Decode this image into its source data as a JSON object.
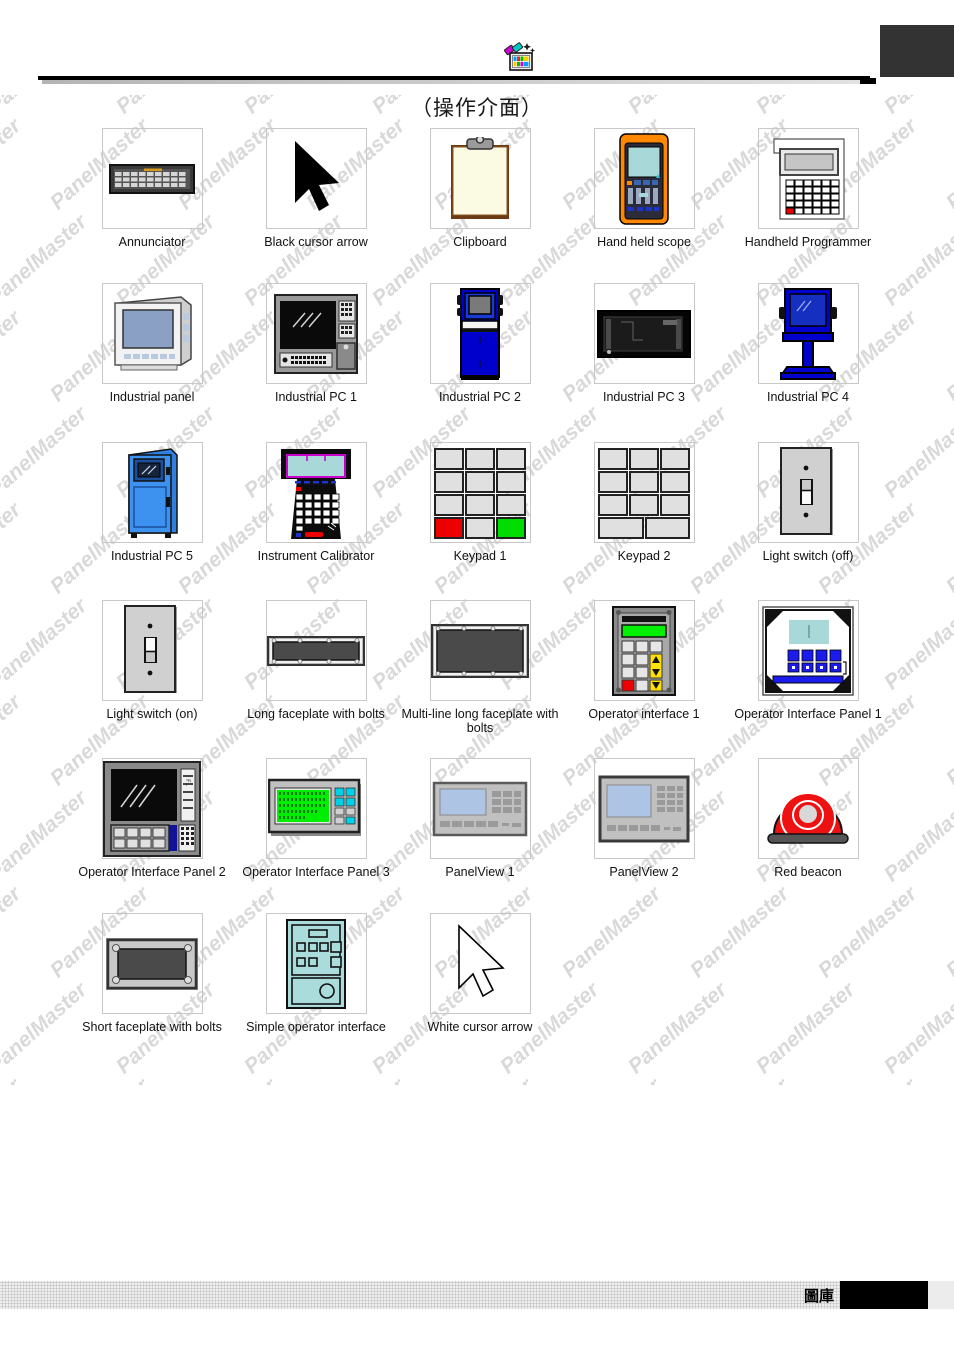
{
  "header": {
    "icon": "magic-wand-palette-icon",
    "title": "（操作介面）",
    "corner_marker": ""
  },
  "footer": {
    "label": "圖庫",
    "black_bar": ""
  },
  "watermark": {
    "text": "PanelMaster"
  },
  "gallery": {
    "columns": 5,
    "items": [
      {
        "id": "annunciator",
        "label": "Annunciator",
        "icon": "annunciator-icon"
      },
      {
        "id": "black-cursor-arrow",
        "label": "Black cursor arrow",
        "icon": "black-cursor-arrow-icon"
      },
      {
        "id": "clipboard",
        "label": "Clipboard",
        "icon": "clipboard-icon"
      },
      {
        "id": "hand-held-scope",
        "label": "Hand held scope",
        "icon": "hand-held-scope-icon"
      },
      {
        "id": "handheld-programmer",
        "label": "Handheld Programmer",
        "icon": "handheld-programmer-icon"
      },
      {
        "id": "industrial-panel",
        "label": "Industrial panel",
        "icon": "industrial-panel-icon"
      },
      {
        "id": "industrial-pc-1",
        "label": "Industrial PC 1",
        "icon": "industrial-pc-1-icon"
      },
      {
        "id": "industrial-pc-2",
        "label": "Industrial PC 2",
        "icon": "industrial-pc-2-icon"
      },
      {
        "id": "industrial-pc-3",
        "label": "Industrial PC 3",
        "icon": "industrial-pc-3-icon"
      },
      {
        "id": "industrial-pc-4",
        "label": "Industrial PC 4",
        "icon": "industrial-pc-4-icon"
      },
      {
        "id": "industrial-pc-5",
        "label": "Industrial PC 5",
        "icon": "industrial-pc-5-icon"
      },
      {
        "id": "instrument-calibrator",
        "label": "Instrument Calibrator",
        "icon": "instrument-calibrator-icon"
      },
      {
        "id": "keypad-1",
        "label": "Keypad 1",
        "icon": "keypad-1-icon"
      },
      {
        "id": "keypad-2",
        "label": "Keypad 2",
        "icon": "keypad-2-icon"
      },
      {
        "id": "light-switch-off",
        "label": "Light switch (off)",
        "icon": "light-switch-off-icon"
      },
      {
        "id": "light-switch-on",
        "label": "Light switch (on)",
        "icon": "light-switch-on-icon"
      },
      {
        "id": "long-faceplate-with-bolts",
        "label": "Long faceplate with bolts",
        "icon": "long-faceplate-with-bolts-icon"
      },
      {
        "id": "multi-line-long-faceplate",
        "label": "Multi-line long faceplate with bolts",
        "icon": "multi-line-long-faceplate-icon"
      },
      {
        "id": "operator-interface-1",
        "label": "Operator interface 1",
        "icon": "operator-interface-1-icon"
      },
      {
        "id": "operator-interface-panel-1",
        "label": "Operator Interface Panel 1",
        "icon": "operator-interface-panel-1-icon"
      },
      {
        "id": "operator-interface-panel-2",
        "label": "Operator Interface Panel 2",
        "icon": "operator-interface-panel-2-icon"
      },
      {
        "id": "operator-interface-panel-3",
        "label": "Operator Interface Panel 3",
        "icon": "operator-interface-panel-3-icon"
      },
      {
        "id": "panelview-1",
        "label": "PanelView 1",
        "icon": "panelview-1-icon"
      },
      {
        "id": "panelview-2",
        "label": "PanelView 2",
        "icon": "panelview-2-icon"
      },
      {
        "id": "red-beacon",
        "label": "Red beacon",
        "icon": "red-beacon-icon"
      },
      {
        "id": "short-faceplate-with-bolts",
        "label": "Short faceplate with bolts",
        "icon": "short-faceplate-with-bolts-icon"
      },
      {
        "id": "simple-operator-interface",
        "label": "Simple operator interface",
        "icon": "simple-operator-interface-icon"
      },
      {
        "id": "white-cursor-arrow",
        "label": "White cursor arrow",
        "icon": "white-cursor-arrow-icon"
      }
    ]
  },
  "colors": {
    "industrial_blue": "#0000cc",
    "bright_blue": "#1a6fe0",
    "lcd_green": "#00ee00",
    "lcd_cyan": "#a8d8d8",
    "beacon_red": "#ee1111",
    "orange": "#ff8800",
    "key_red": "#ee0000",
    "key_green": "#00dd00",
    "gray_body": "#c8c8c8",
    "dark_gray": "#4a4a4a",
    "corner_box": "#333333"
  }
}
